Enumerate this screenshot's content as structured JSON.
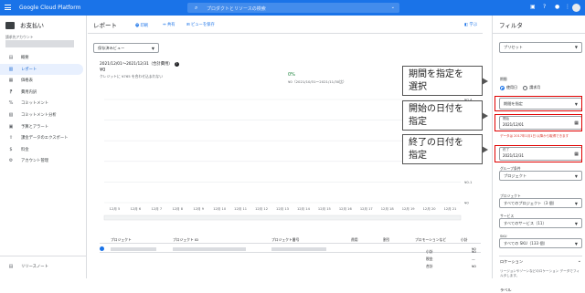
{
  "topbar": {
    "brand": "Google Cloud Platform",
    "search_placeholder": "プロダクトとリソースの検索"
  },
  "sidebar": {
    "title": "お支払い",
    "account_label": "請求先アカウント",
    "items": [
      {
        "icon": "overview-icon",
        "glyph": "▤",
        "label": "概要"
      },
      {
        "icon": "reports-icon",
        "glyph": "▥",
        "label": "レポート"
      },
      {
        "icon": "cost-table-icon",
        "glyph": "▦",
        "label": "価格表"
      },
      {
        "icon": "cost-breakdown-icon",
        "glyph": "⁋",
        "label": "費用内訳"
      },
      {
        "icon": "commitment-icon",
        "glyph": "%",
        "label": "コミットメント"
      },
      {
        "icon": "commitment-analysis-icon",
        "glyph": "▧",
        "label": "コミットメント分析"
      },
      {
        "icon": "budget-icon",
        "glyph": "▣",
        "label": "予算とアラート"
      },
      {
        "icon": "export-icon",
        "glyph": "⇪",
        "label": "課金データのエクスポート"
      },
      {
        "icon": "payment-icon",
        "glyph": "$",
        "label": "料金"
      },
      {
        "icon": "account-icon",
        "glyph": "⚙",
        "label": "アカウント管理"
      }
    ],
    "release_notes": "リリースノート"
  },
  "main": {
    "title": "レポート",
    "actions": {
      "print": "印刷",
      "share": "共有",
      "save_view": "ビューを保存"
    },
    "learn": "学ぶ",
    "saved_view": "保存済みビュー",
    "summary_title": "2021/12/01～2021/12/31（合計費用）",
    "total_value": "¥0",
    "credit_note": "クレジットに ¥765 を合わせ込まれない",
    "change_pct": "0%",
    "prev_note": "¥0（2021/10/31～2021/11/30比）"
  },
  "chart_data": {
    "type": "bar",
    "categories": [
      "12月 5",
      "12月 6",
      "12月 7",
      "12月 8",
      "12月 9",
      "12月 10",
      "12月 11",
      "12月 12",
      "12月 13",
      "12月 14",
      "12月 15",
      "12月 16",
      "12月 17",
      "12月 18",
      "12月 19",
      "12月 20",
      "12月 21"
    ],
    "values": [
      0,
      0,
      0,
      0,
      0,
      0,
      0,
      0,
      0,
      0,
      0,
      0,
      0,
      0,
      0,
      0,
      0
    ],
    "y_ticks": [
      "¥0.4",
      "¥0.4",
      "¥0.3",
      "¥0.2",
      "¥0.1",
      "¥0"
    ],
    "grid": true
  },
  "table": {
    "columns": [
      "プロジェクト",
      "プロジェクト ID",
      "プロジェクト番号",
      "費用",
      "割引",
      "プロモーションなど",
      "小計"
    ],
    "row": {
      "cost": "",
      "discount": "",
      "promo": "",
      "subtotal": "¥0"
    },
    "totals": [
      {
        "label": "小計",
        "value": "¥0"
      },
      {
        "label": "税金",
        "value": "—"
      },
      {
        "label": "合計",
        "value": "¥0"
      }
    ]
  },
  "filters": {
    "title": "フィルタ",
    "preset": "プリセット",
    "period_label": "期間",
    "radio_usage": "使用日",
    "radio_invoice": "請求月",
    "range_select": "期間を指定",
    "start_label": "開始",
    "start_value": "2021/12/01",
    "warning": "データは 2017年1月1日 以降から取得できます",
    "end_label": "終了",
    "end_value": "2021/12/31",
    "group_label": "グループ条件",
    "group_value": "プロジェクト",
    "project_label": "プロジェクト",
    "project_value": "すべてのプロジェクト（3 個）",
    "service_label": "サービス",
    "service_value": "すべてのサービス（11）",
    "sku_label": "SKU",
    "sku_value": "すべての SKU（133 個）",
    "location_label": "ロケーション",
    "location_note": "リージョンやゾーンなどのロケーション データでフィルタします。",
    "labels_label": "ラベル"
  },
  "annotations": {
    "callout1": "期間を指定を\n選択",
    "callout2": "開始の日付を\n指定",
    "callout3": "終了の日付を\n指定"
  }
}
